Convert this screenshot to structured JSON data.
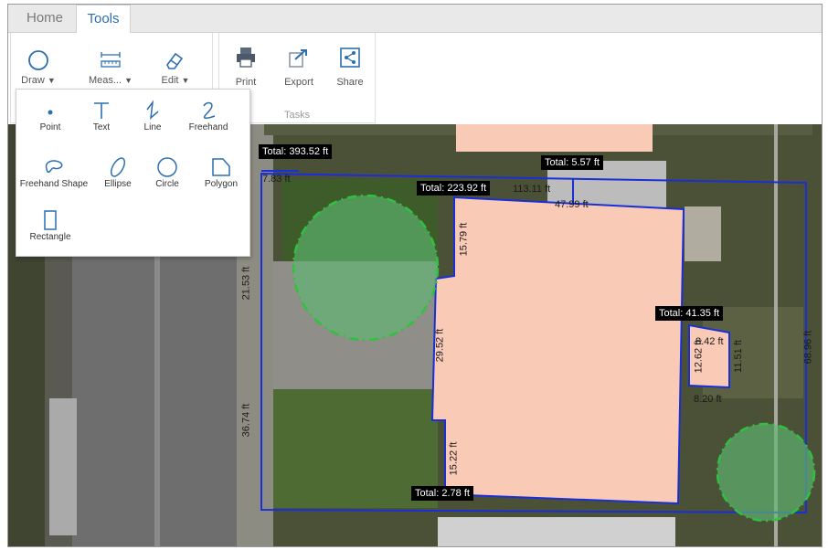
{
  "tabs": [
    {
      "label": "Home",
      "active": false
    },
    {
      "label": "Tools",
      "active": true
    }
  ],
  "ribbon": {
    "draw_label": "Draw",
    "measure_label": "Meas...",
    "edit_label": "Edit",
    "print_label": "Print",
    "export_label": "Export",
    "share_label": "Share",
    "tasks_group_label": "Tasks"
  },
  "draw_menu": {
    "point": "Point",
    "text": "Text",
    "line": "Line",
    "freehand": "Freehand",
    "freehand_shape": "Freehand Shape",
    "ellipse": "Ellipse",
    "circle": "Circle",
    "polygon": "Polygon",
    "rectangle": "Rectangle"
  },
  "map": {
    "totals": {
      "t1": "Total: 393.52 ft",
      "t2": "Total: 5.57 ft",
      "t3": "Total: 223.92 ft",
      "t4": "Total: 41.35 ft",
      "t5": "Total: 2.78 ft"
    },
    "measures": {
      "m_783": "7.83 ft",
      "m_11311": "113.11 ft",
      "m_4799": "47.99 ft",
      "m_1579": "15.79 ft",
      "m_2153": "21.53 ft",
      "m_2952": "29.52 ft",
      "m_3674": "36.74 ft",
      "m_1522": "15.22 ft",
      "m_842": "8.42 ft",
      "m_1262": "12.62 ft",
      "m_1151": "11.51 ft",
      "m_820": "8.20 ft",
      "m_6896": "68.96 ft"
    },
    "colors": {
      "boundary": "#1a2fd6",
      "house_fill": "#f9cbb6",
      "tree_fill": "#5fb872",
      "tree_stroke": "#2fc23f",
      "aerial_dark": "#4b5137",
      "road": "#6e6e6e"
    }
  }
}
